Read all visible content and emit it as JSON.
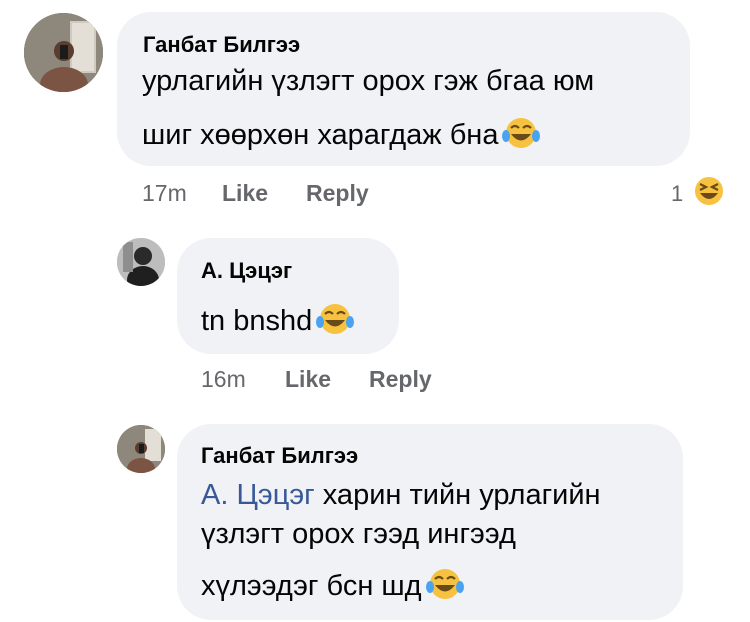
{
  "comments": [
    {
      "author": "Ганбат Билгээ",
      "lines": [
        "урлагийн үзлэгт орох гэж бгаа юм",
        "шиг хөөрхөн харагдаж бна"
      ],
      "emoji": "laughing-tears-emoji",
      "time": "17m",
      "like": "Like",
      "reply": "Reply",
      "reaction_count": "1",
      "reaction_icon": "laughing-squint-emoji"
    },
    {
      "author": "А. Цэцэг",
      "lines": [
        "tn bnshd"
      ],
      "emoji": "laughing-tears-emoji",
      "time": "16m",
      "like": "Like",
      "reply": "Reply"
    },
    {
      "author": "Ганбат Билгээ",
      "mention": "А. Цэцэг",
      "lines": [
        " харин тийн урлагийн",
        "үзлэгт орох гээд ингээд",
        "хүлээдэг бсн шд"
      ],
      "emoji": "laughing-tears-emoji"
    }
  ],
  "colors": {
    "bubble": "#f0f2f5",
    "mention": "#385898",
    "meta": "#65676b",
    "emoji": "#f7c23f"
  }
}
